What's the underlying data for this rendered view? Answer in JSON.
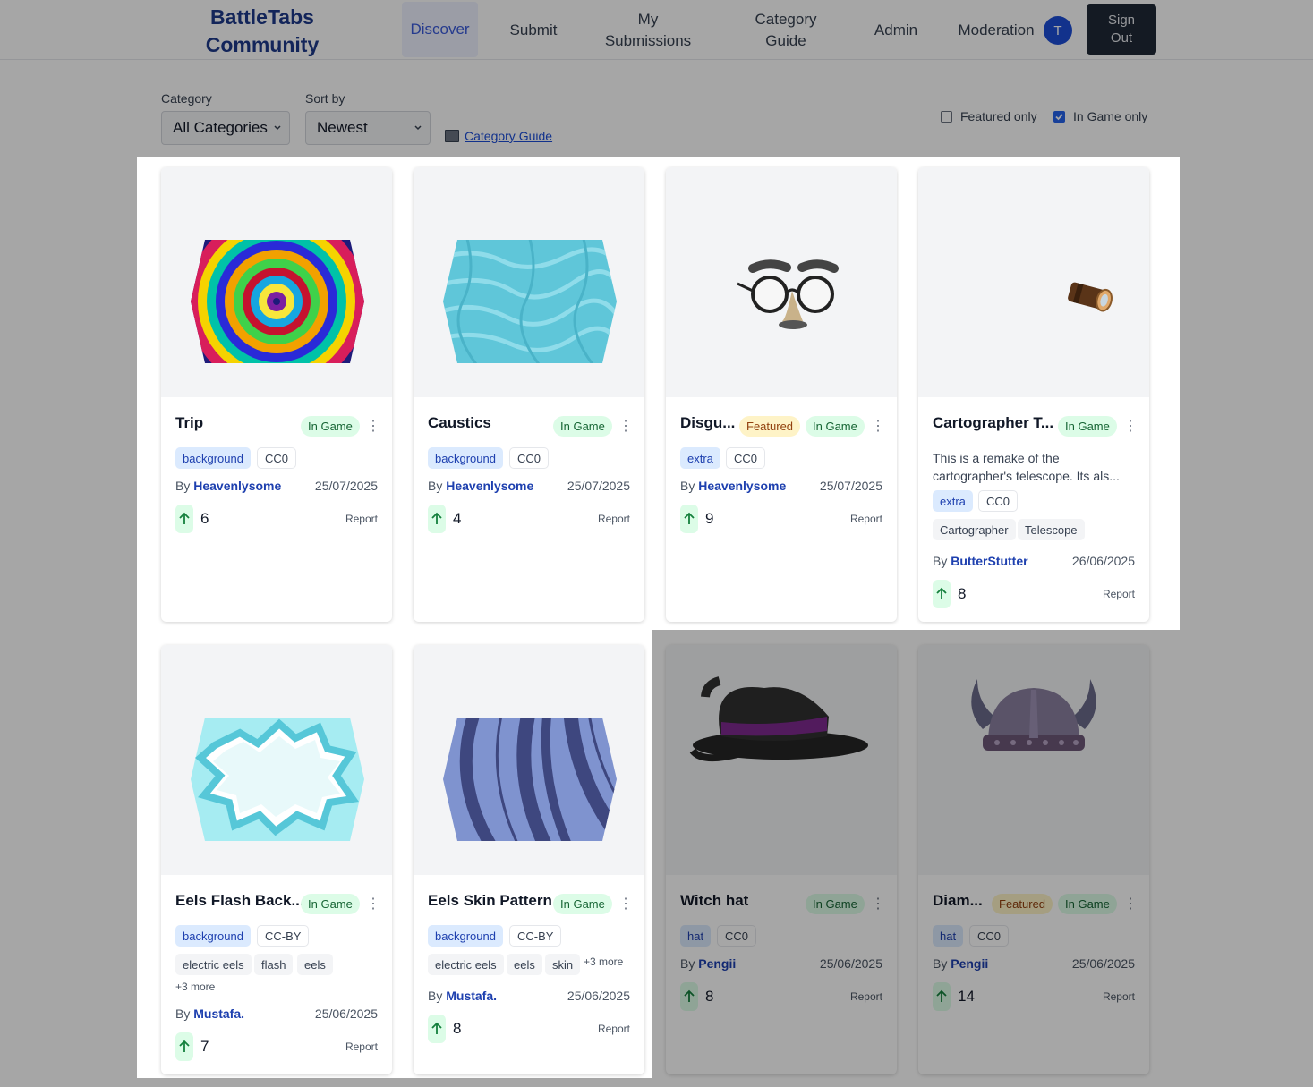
{
  "header": {
    "logo_line1": "BattleTabs",
    "logo_line2": "Community",
    "nav": {
      "discover": "Discover",
      "submit": "Submit",
      "my_submissions_1": "My",
      "my_submissions_2": "Submissions",
      "category_guide_1": "Category",
      "category_guide_2": "Guide",
      "admin": "Admin",
      "moderation": "Moderation"
    },
    "avatar_initial": "T",
    "signout_1": "Sign",
    "signout_2": "Out",
    "accent": "#1e3a8a"
  },
  "filters": {
    "category_label": "Category",
    "category_value": "All Categories",
    "sort_label": "Sort by",
    "sort_value": "Newest",
    "guide_link": "Category Guide",
    "featured_only": "Featured only",
    "featured_only_checked": false,
    "in_game_only": "In Game only",
    "in_game_only_checked": true
  },
  "labels": {
    "by": "By",
    "report": "Report",
    "in_game": "In Game",
    "featured": "Featured"
  },
  "cards": [
    {
      "title": "Trip",
      "category": "background",
      "license": "CC0",
      "author": "Heavenlysome",
      "date": "25/07/2025",
      "votes": "6",
      "featured": false,
      "image": "psychedelic-spiral-hexagon"
    },
    {
      "title": "Caustics",
      "category": "background",
      "license": "CC0",
      "author": "Heavenlysome",
      "date": "25/07/2025",
      "votes": "4",
      "featured": false,
      "image": "water-caustics-hexagon"
    },
    {
      "title": "Disgu...",
      "category": "extra",
      "license": "CC0",
      "author": "Heavenlysome",
      "date": "25/07/2025",
      "votes": "9",
      "featured": true,
      "image": "disguise-glasses"
    },
    {
      "title": "Cartographer T...",
      "category": "extra",
      "license": "CC0",
      "description_1": "This is a remake of the",
      "description_2": "cartographer's telescope. Its als...",
      "tags": [
        "Cartographer",
        "Telescope"
      ],
      "author": "ButterStutter",
      "date": "26/06/2025",
      "votes": "8",
      "featured": false,
      "image": "telescope"
    },
    {
      "title": "Eels Flash Back...",
      "category": "background",
      "license": "CC-BY",
      "tags": [
        "electric eels",
        "flash",
        "eels"
      ],
      "more": "+3 more",
      "author": "Mustafa.",
      "date": "25/06/2025",
      "votes": "7",
      "featured": false,
      "image": "flash-burst-hexagon"
    },
    {
      "title": "Eels Skin Pattern",
      "category": "background",
      "license": "CC-BY",
      "tags": [
        "electric eels",
        "eels",
        "skin"
      ],
      "more": "+3 more",
      "author": "Mustafa.",
      "date": "25/06/2025",
      "votes": "8",
      "featured": false,
      "image": "eel-stripes-hexagon"
    },
    {
      "title": "Witch hat",
      "category": "hat",
      "license": "CC0",
      "author": "Pengii",
      "date": "25/06/2025",
      "votes": "8",
      "featured": false,
      "image": "witch-hat"
    },
    {
      "title": "Diam...",
      "category": "hat",
      "license": "CC0",
      "author": "Pengii",
      "date": "25/06/2025",
      "votes": "14",
      "featured": true,
      "image": "viking-helmet"
    }
  ],
  "colors": {
    "in_game_bg": "#dcfce7",
    "featured_bg": "#fef3c7",
    "category_tag_bg": "#dbeafe",
    "link": "#1e40af"
  }
}
